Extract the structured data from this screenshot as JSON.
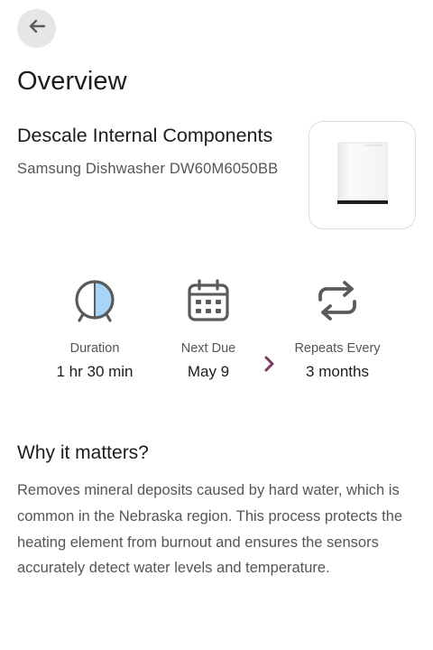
{
  "header": {
    "back_icon": "arrow-left-icon",
    "title": "Overview"
  },
  "task": {
    "title": "Descale Internal Components",
    "device": "Samsung Dishwasher DW60M6050BB",
    "device_image_icon": "dishwasher-image"
  },
  "stats": {
    "duration": {
      "icon": "timer-icon",
      "label": "Duration",
      "value": "1 hr 30 min"
    },
    "next_due": {
      "icon": "calendar-icon",
      "label": "Next Due",
      "value": "May 9",
      "action_icon": "chevron-right-icon"
    },
    "repeats": {
      "icon": "repeat-icon",
      "label": "Repeats Every",
      "value": "3 months"
    }
  },
  "why": {
    "title": "Why it matters?",
    "body": "Removes mineral deposits caused by hard water, which is common in the Nebraska region. This process protects the heating element from burnout and ensures the sensors accurately detect water levels and temperature."
  },
  "colors": {
    "icon_gray": "#5a5a5a",
    "timer_fill": "#a9d4f5",
    "accent_chevron": "#7a3b5e",
    "back_bg": "#e6e6e6"
  }
}
